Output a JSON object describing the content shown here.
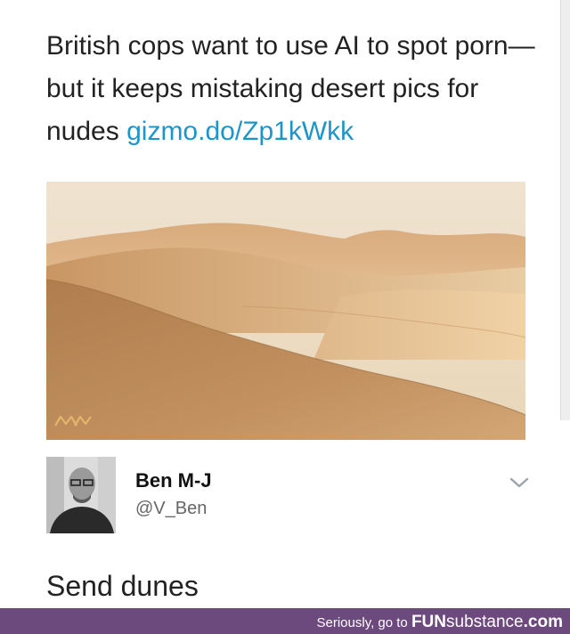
{
  "tweet": {
    "text": "British cops want to use AI to spot porn—but it keeps mistaking desert pics for nudes",
    "link": "gizmo.do/Zp1kWkk"
  },
  "reply": {
    "author_name": "Ben M-J",
    "author_handle": "@V_Ben",
    "text": "Send dunes"
  },
  "footer": {
    "prefix": "Seriously, go to",
    "brand_bold": "FUN",
    "brand_rest": "substance",
    "brand_suffix": ".com"
  },
  "icons": {
    "menu": "chevron-down-icon",
    "photo_watermark": "watermark-icon"
  },
  "colors": {
    "link": "#1d95c9",
    "footer_bg": "#6d4a7d",
    "sand_light": "#e8c9a0",
    "sand_dark": "#a77a4c"
  }
}
